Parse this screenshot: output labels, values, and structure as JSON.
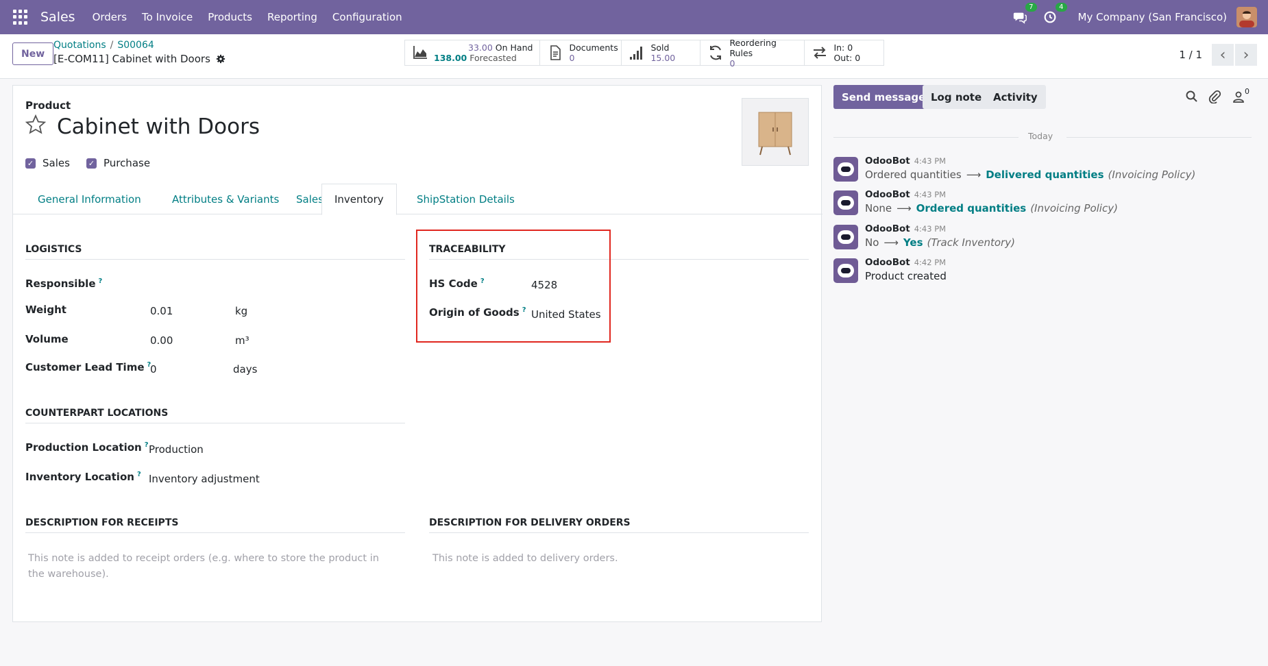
{
  "navbar": {
    "brand": "Sales",
    "menu": [
      "Orders",
      "To Invoice",
      "Products",
      "Reporting",
      "Configuration"
    ],
    "messages_count": "7",
    "activities_count": "4",
    "company": "My Company (San Francisco)",
    "icons": [
      "apps-grid-icon",
      "chat-icon",
      "clock-icon",
      "avatar"
    ]
  },
  "control": {
    "new_label": "New",
    "breadcrumb": [
      "Quotations",
      "S00064"
    ],
    "record_title": "[E-COM11] Cabinet with Doors",
    "pager": "1 / 1",
    "smart_buttons": {
      "on_hand_value": "33.00",
      "on_hand_label": "On Hand",
      "forecast_value": "138.00",
      "forecast_label": "Forecasted",
      "documents_label": "Documents",
      "documents_value": "0",
      "sold_label": "Sold",
      "sold_value": "15.00",
      "reorder_label": "Reordering Rules",
      "reorder_value": "0",
      "in_label": "In: 0",
      "out_label": "Out: 0"
    }
  },
  "form": {
    "product_label": "Product",
    "product_name": "Cabinet with Doors",
    "sales_label": "Sales",
    "purchase_label": "Purchase",
    "tabs": [
      "General Information",
      "Attributes & Variants",
      "Sales",
      "Inventory",
      "ShipStation Details"
    ],
    "active_tab": "Inventory",
    "logistics": {
      "title": "LOGISTICS",
      "responsible_label": "Responsible",
      "weight_label": "Weight",
      "weight_value": "0.01",
      "weight_unit": "kg",
      "volume_label": "Volume",
      "volume_value": "0.00",
      "volume_unit": "m³",
      "lead_time_label": "Customer Lead Time",
      "lead_time_value": "0",
      "lead_time_unit": "days"
    },
    "traceability": {
      "title": "TRACEABILITY",
      "hs_code_label": "HS Code",
      "hs_code_value": "4528",
      "origin_label": "Origin of Goods",
      "origin_value": "United States"
    },
    "counterpart": {
      "title": "COUNTERPART LOCATIONS",
      "production_label": "Production Location",
      "production_value": "Production",
      "inventory_label": "Inventory Location",
      "inventory_value": "Inventory adjustment"
    },
    "receipts": {
      "title": "DESCRIPTION FOR RECEIPTS",
      "placeholder_line1": "This note is added to receipt orders (e.g. where to store the product in",
      "placeholder_line2": "the warehouse)."
    },
    "delivery": {
      "title": "DESCRIPTION FOR DELIVERY ORDERS",
      "placeholder": "This note is added to delivery orders."
    },
    "help_mark": "?"
  },
  "chatter": {
    "send_message": "Send message",
    "log_note": "Log note",
    "activity": "Activity",
    "followers_count": "0",
    "today": "Today",
    "messages": [
      {
        "author": "OdooBot",
        "time": "4:43 PM",
        "old": "Ordered quantities",
        "new": "Delivered quantities",
        "field": "(Invoicing Policy)"
      },
      {
        "author": "OdooBot",
        "time": "4:43 PM",
        "old": "None",
        "new": "Ordered quantities",
        "field": "(Invoicing Policy)"
      },
      {
        "author": "OdooBot",
        "time": "4:43 PM",
        "old": "No",
        "new": "Yes",
        "field": "(Track Inventory)"
      },
      {
        "author": "OdooBot",
        "time": "4:42 PM",
        "text": "Product created"
      }
    ],
    "arrow": "⟶"
  },
  "colors": {
    "brand": "#71639e",
    "link": "#017e84",
    "highlight": "#e0261e"
  }
}
